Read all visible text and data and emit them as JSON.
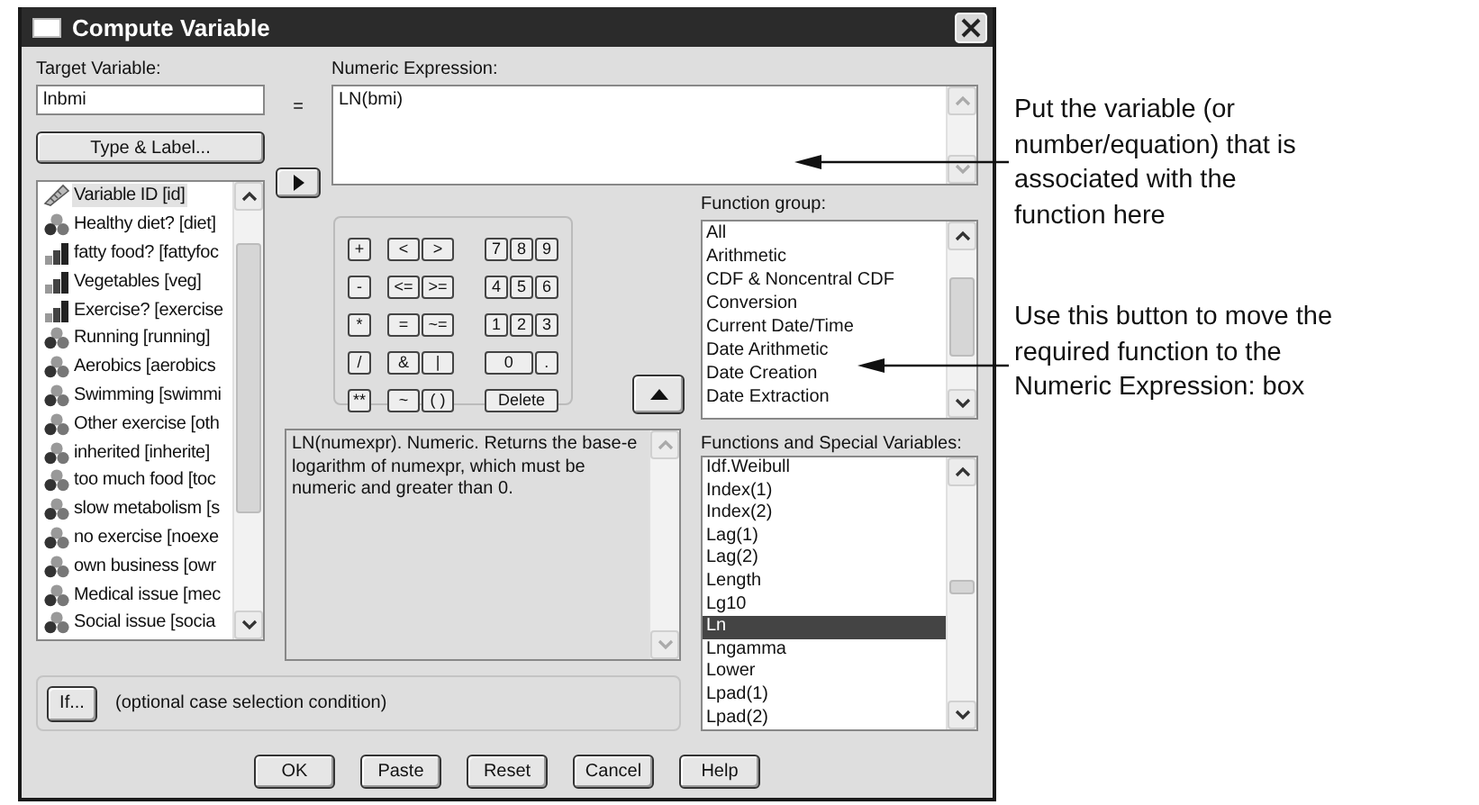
{
  "window": {
    "title": "Compute Variable"
  },
  "target_variable": {
    "label": "Target Variable:",
    "value": "lnbmi"
  },
  "equals": "=",
  "type_label_button": "Type & Label...",
  "numeric_expression": {
    "label": "Numeric Expression:",
    "value": "LN(bmi)"
  },
  "variables": [
    {
      "name": "Variable ID [id]",
      "kind": "scale",
      "selected": true
    },
    {
      "name": "Healthy diet? [diet]",
      "kind": "nominal",
      "selected": false
    },
    {
      "name": "fatty food? [fattyfoc",
      "kind": "ordinal",
      "selected": false
    },
    {
      "name": "Vegetables [veg]",
      "kind": "ordinal",
      "selected": false
    },
    {
      "name": "Exercise? [exercise",
      "kind": "ordinal",
      "selected": false
    },
    {
      "name": "Running [running]",
      "kind": "nominal",
      "selected": false
    },
    {
      "name": "Aerobics [aerobics",
      "kind": "nominal",
      "selected": false
    },
    {
      "name": "Swimming [swimmi",
      "kind": "nominal",
      "selected": false
    },
    {
      "name": "Other exercise [oth",
      "kind": "nominal",
      "selected": false
    },
    {
      "name": "inherited [inherite]",
      "kind": "nominal",
      "selected": false
    },
    {
      "name": "too much food [toc",
      "kind": "nominal",
      "selected": false
    },
    {
      "name": "slow metabolism [s",
      "kind": "nominal",
      "selected": false
    },
    {
      "name": "no exercise [noexe",
      "kind": "nominal",
      "selected": false
    },
    {
      "name": "own business [owr",
      "kind": "nominal",
      "selected": false
    },
    {
      "name": "Medical issue [mec",
      "kind": "nominal",
      "selected": false
    },
    {
      "name": "Social issue [socia",
      "kind": "nominal",
      "selected": false
    }
  ],
  "keypad": [
    [
      [
        "+"
      ],
      [
        "<",
        ">"
      ],
      [
        "7",
        "8",
        "9"
      ]
    ],
    [
      [
        "-"
      ],
      [
        "<=",
        ">="
      ],
      [
        "4",
        "5",
        "6"
      ]
    ],
    [
      [
        "*"
      ],
      [
        "=",
        "~="
      ],
      [
        "1",
        "2",
        "3"
      ]
    ],
    [
      [
        "/"
      ],
      [
        "&",
        "|"
      ],
      [
        "0",
        "."
      ]
    ],
    [
      [
        "**"
      ],
      [
        "~",
        "( )"
      ],
      [
        "Delete"
      ]
    ]
  ],
  "description": "LN(numexpr). Numeric. Returns the base-e logarithm of numexpr, which must be numeric and greater than 0.",
  "function_group": {
    "label": "Function group:",
    "items": [
      {
        "label": "All",
        "selected": false
      },
      {
        "label": "Arithmetic",
        "selected": false
      },
      {
        "label": "CDF & Noncentral CDF",
        "selected": false
      },
      {
        "label": "Conversion",
        "selected": false
      },
      {
        "label": "Current Date/Time",
        "selected": false
      },
      {
        "label": "Date Arithmetic",
        "selected": false
      },
      {
        "label": "Date Creation",
        "selected": false
      },
      {
        "label": "Date Extraction",
        "selected": false
      }
    ]
  },
  "functions": {
    "label": "Functions and Special Variables:",
    "items": [
      {
        "label": "Idf.Weibull",
        "selected": false
      },
      {
        "label": "Index(1)",
        "selected": false
      },
      {
        "label": "Index(2)",
        "selected": false
      },
      {
        "label": "Lag(1)",
        "selected": false
      },
      {
        "label": "Lag(2)",
        "selected": false
      },
      {
        "label": "Length",
        "selected": false
      },
      {
        "label": "Lg10",
        "selected": false
      },
      {
        "label": "Ln",
        "selected": true
      },
      {
        "label": "Lngamma",
        "selected": false
      },
      {
        "label": "Lower",
        "selected": false
      },
      {
        "label": "Lpad(1)",
        "selected": false
      },
      {
        "label": "Lpad(2)",
        "selected": false
      }
    ]
  },
  "if_button": "If...",
  "if_condition": "(optional case selection condition)",
  "buttons": [
    "OK",
    "Paste",
    "Reset",
    "Cancel",
    "Help"
  ],
  "annotations": [
    {
      "lines": [
        "Put the variable (or",
        "number/equation) that is",
        "associated with the",
        "function here"
      ]
    },
    {
      "lines": [
        "Use this button to move the",
        "required function to the",
        "Numeric Expression: box"
      ]
    }
  ]
}
